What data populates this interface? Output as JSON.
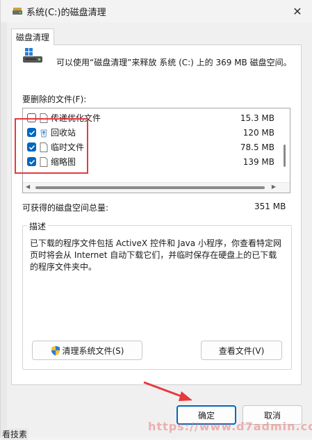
{
  "window": {
    "title": "系统(C:)的磁盘清理"
  },
  "tabs": [
    {
      "label": "磁盘清理"
    }
  ],
  "intro": "可以使用“磁盘清理”来释放 系统 (C:) 上的 369 MB 磁盘空间。",
  "files_label": "要删除的文件(F):",
  "files": [
    {
      "name": "传递优化文件",
      "size": "15.3 MB",
      "checked": false,
      "icon": "file-icon"
    },
    {
      "name": "回收站",
      "size": "120 MB",
      "checked": true,
      "icon": "recycle-bin-icon"
    },
    {
      "name": "临时文件",
      "size": "78.5 MB",
      "checked": true,
      "icon": "file-icon"
    },
    {
      "name": "缩略图",
      "size": "139 MB",
      "checked": true,
      "icon": "file-icon"
    }
  ],
  "space_label": "可获得的磁盘空间总量:",
  "space_value": "351 MB",
  "description": {
    "title": "描述",
    "text": "已下载的程序文件包括 ActiveX 控件和 Java 小程序，你查看特定网页时将会从 Internet 自动下载它们，并临时保存在硬盘上的已下载的程序文件夹中。"
  },
  "buttons": {
    "cleanup_system": "清理系统文件(S)",
    "view_files": "查看文件(V)",
    "ok": "确定",
    "cancel": "取消"
  },
  "watermark": "https://www.d7admin.cc",
  "bottom_fragment": "看技素"
}
